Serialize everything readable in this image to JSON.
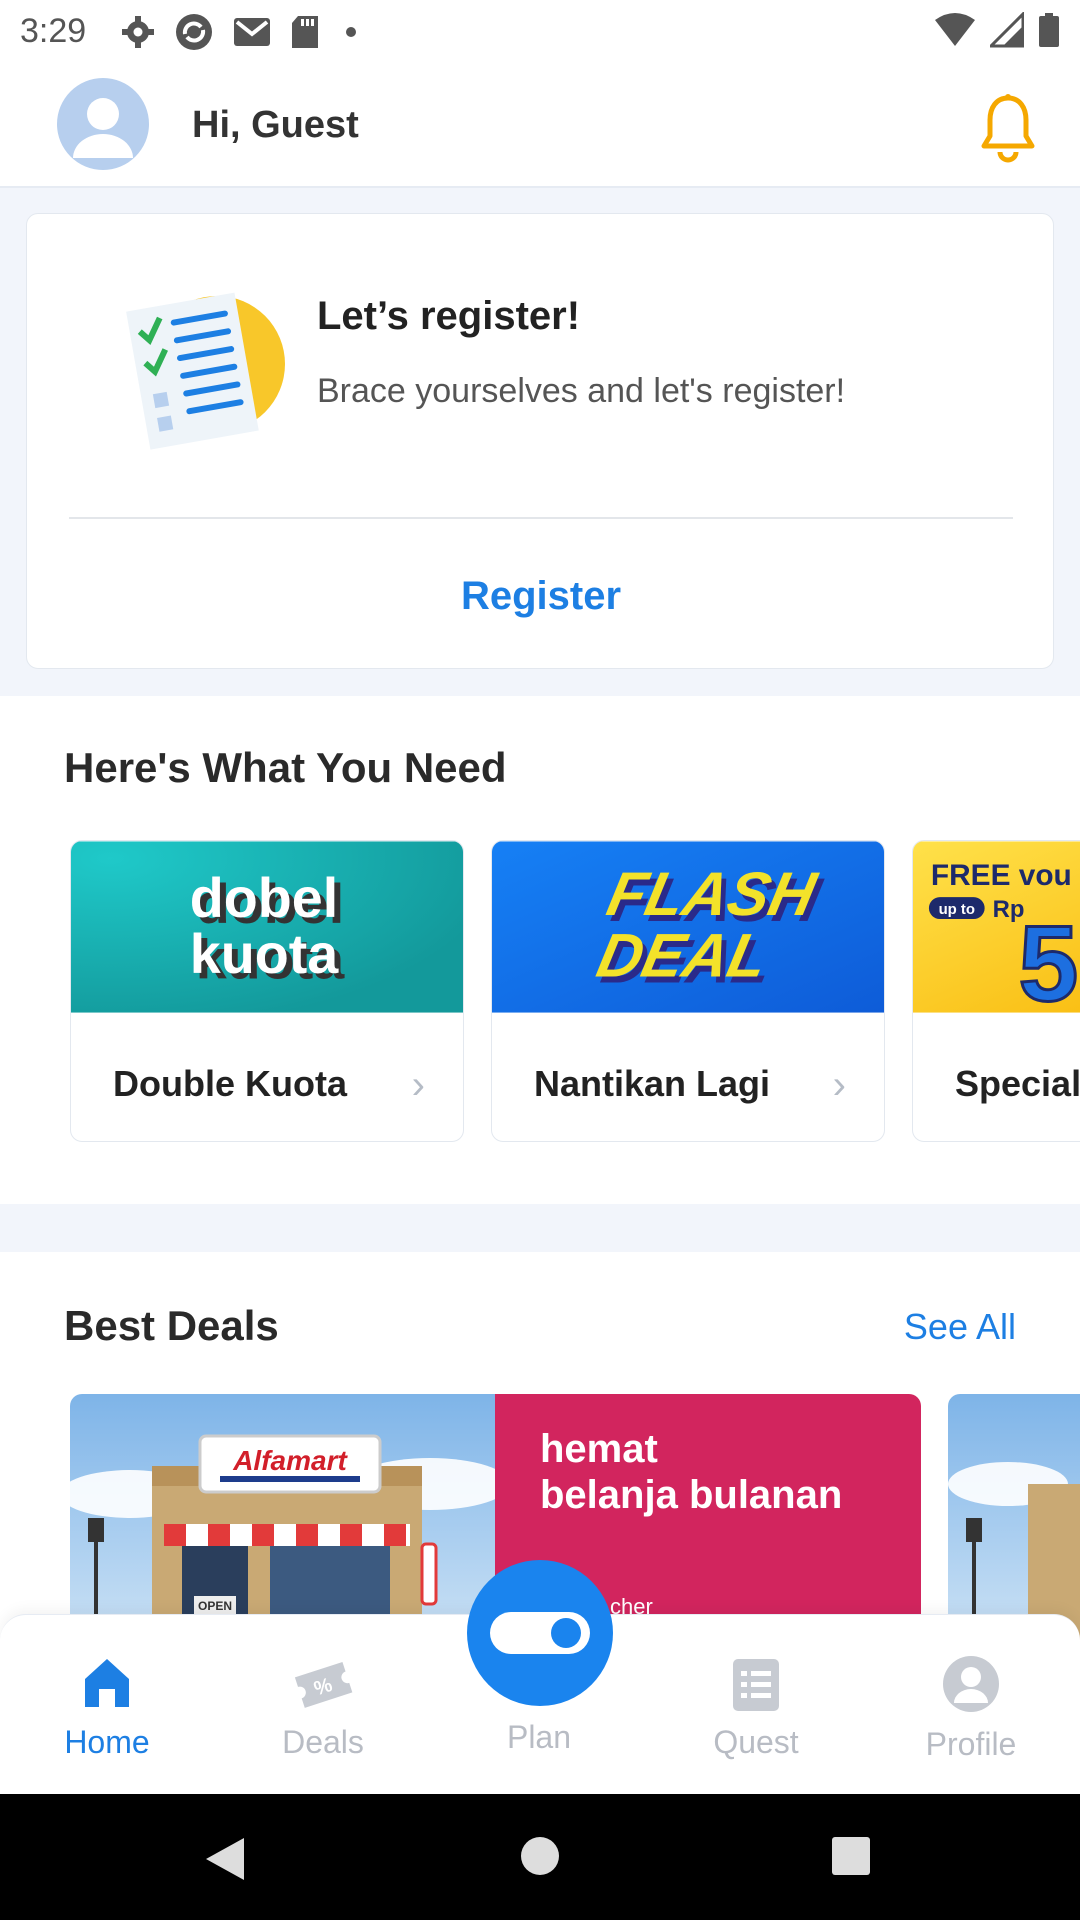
{
  "status_bar": {
    "time": "3:29",
    "icons": [
      "settings-icon",
      "sync-icon",
      "gmail-icon",
      "sd-card-icon",
      "dot-icon"
    ],
    "right_icons": [
      "wifi-icon",
      "signal-icon",
      "battery-icon"
    ]
  },
  "header": {
    "greeting": "Hi, Guest",
    "icons": [
      "avatar-icon",
      "bell-icon"
    ],
    "accent_color": "#F5A800"
  },
  "register_card": {
    "title": "Let’s register!",
    "subtitle": "Brace yourselves and let's register!",
    "button_label": "Register",
    "illustration": "checklist-icon"
  },
  "needs_section": {
    "title": "Here's What You Need",
    "cards": [
      {
        "image_text": [
          "dobel",
          "kuota"
        ],
        "label": "Double Kuota",
        "bg": "#18A9A9"
      },
      {
        "image_text": [
          "FLASH",
          "DEAL"
        ],
        "label": "Nantikan Lagi",
        "bg": "#1370E6"
      },
      {
        "image_text": [
          "FREE vou",
          "up to",
          "Rp",
          "5"
        ],
        "label": "Special",
        "bg": "#FFC21A"
      }
    ]
  },
  "best_deals": {
    "title": "Best Deals",
    "see_all": "See All",
    "banner": {
      "brand": "Alfamart",
      "sign": "OPEN",
      "headline": [
        "hemat",
        "belanja bulanan"
      ],
      "partial_text": "cher",
      "bg": "#D2255E"
    }
  },
  "bottom_nav": {
    "items": [
      {
        "label": "Home",
        "icon": "home-icon",
        "active": true
      },
      {
        "label": "Deals",
        "icon": "ticket-icon",
        "active": false
      },
      {
        "label": "Plan",
        "icon": "toggle-icon",
        "active": false
      },
      {
        "label": "Quest",
        "icon": "clipboard-icon",
        "active": false
      },
      {
        "label": "Profile",
        "icon": "profile-icon",
        "active": false
      }
    ],
    "active_color": "#1D7FE3",
    "inactive_color": "#B8BCC4"
  },
  "system_nav": {
    "icons": [
      "back-icon",
      "home-circle-icon",
      "recents-icon"
    ]
  }
}
